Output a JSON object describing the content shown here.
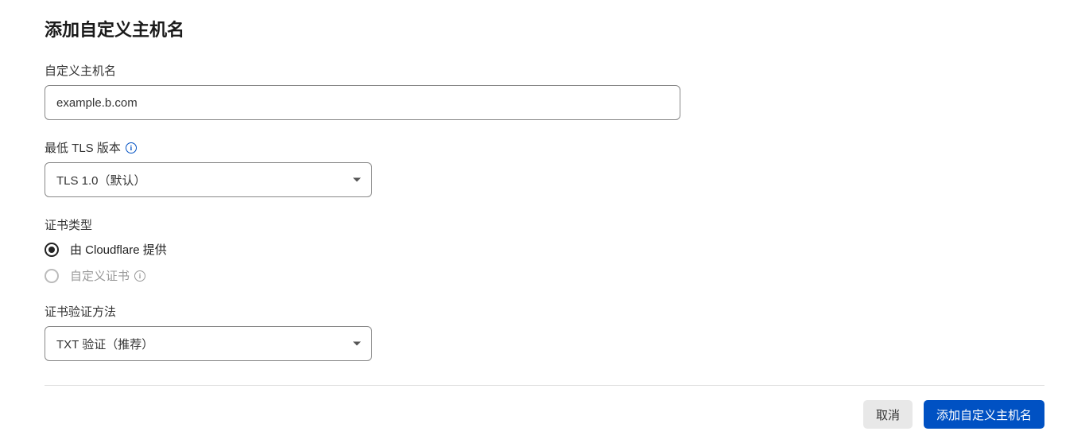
{
  "title": "添加自定义主机名",
  "hostname": {
    "label": "自定义主机名",
    "value": "example.b.com"
  },
  "tls": {
    "label": "最低 TLS 版本",
    "selected": "TLS 1.0（默认）"
  },
  "certType": {
    "label": "证书类型",
    "options": [
      {
        "label": "由 Cloudflare 提供",
        "selected": true,
        "disabled": false
      },
      {
        "label": "自定义证书",
        "selected": false,
        "disabled": true
      }
    ]
  },
  "certValidation": {
    "label": "证书验证方法",
    "selected": "TXT 验证（推荐）"
  },
  "footer": {
    "cancel": "取消",
    "submit": "添加自定义主机名"
  }
}
